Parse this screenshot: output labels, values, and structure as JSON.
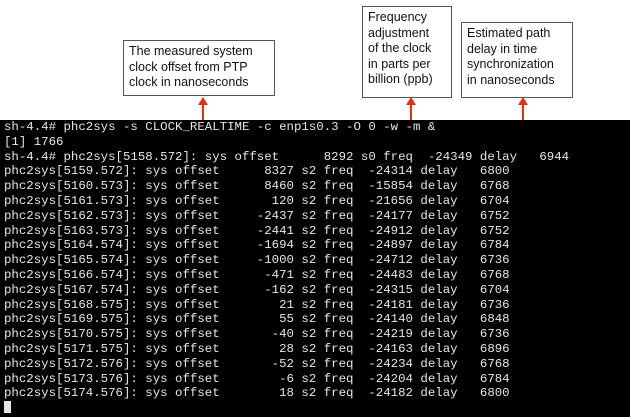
{
  "callouts": {
    "offset": [
      "The measured system",
      "clock offset from PTP",
      "clock in nanoseconds"
    ],
    "freq": [
      "Frequency",
      "adjustment",
      "of the clock",
      "in parts per",
      "billion (ppb)"
    ],
    "delay": [
      "Estimated path",
      "delay in time",
      "synchronization",
      "in nanoseconds"
    ]
  },
  "colors": {
    "arrow": "#e03010",
    "terminal_bg": "#000000",
    "terminal_fg": "#e6e6e6"
  },
  "terminal": {
    "lines": [
      "sh-4.4# phc2sys -s CLOCK_REALTIME -c enp1s0.3 -O 0 -w -m &",
      "[1] 1766",
      "sh-4.4# phc2sys[5158.572]: sys offset      8292 s0 freq  -24349 delay   6944",
      "phc2sys[5159.572]: sys offset      8327 s2 freq  -24314 delay   6800",
      "phc2sys[5160.573]: sys offset      8460 s2 freq  -15854 delay   6768",
      "phc2sys[5161.573]: sys offset       120 s2 freq  -21656 delay   6704",
      "phc2sys[5162.573]: sys offset     -2437 s2 freq  -24177 delay   6752",
      "phc2sys[5163.573]: sys offset     -2441 s2 freq  -24912 delay   6752",
      "phc2sys[5164.574]: sys offset     -1694 s2 freq  -24897 delay   6784",
      "phc2sys[5165.574]: sys offset     -1000 s2 freq  -24712 delay   6736",
      "phc2sys[5166.574]: sys offset      -471 s2 freq  -24483 delay   6768",
      "phc2sys[5167.574]: sys offset      -162 s2 freq  -24315 delay   6704",
      "phc2sys[5168.575]: sys offset        21 s2 freq  -24181 delay   6736",
      "phc2sys[5169.575]: sys offset        55 s2 freq  -24140 delay   6848",
      "phc2sys[5170.575]: sys offset       -40 s2 freq  -24219 delay   6736",
      "phc2sys[5171.575]: sys offset        28 s2 freq  -24163 delay   6896",
      "phc2sys[5172.576]: sys offset       -52 s2 freq  -24234 delay   6768",
      "phc2sys[5173.576]: sys offset        -6 s2 freq  -24204 delay   6784",
      "phc2sys[5174.576]: sys offset        18 s2 freq  -24182 delay   6800"
    ]
  }
}
